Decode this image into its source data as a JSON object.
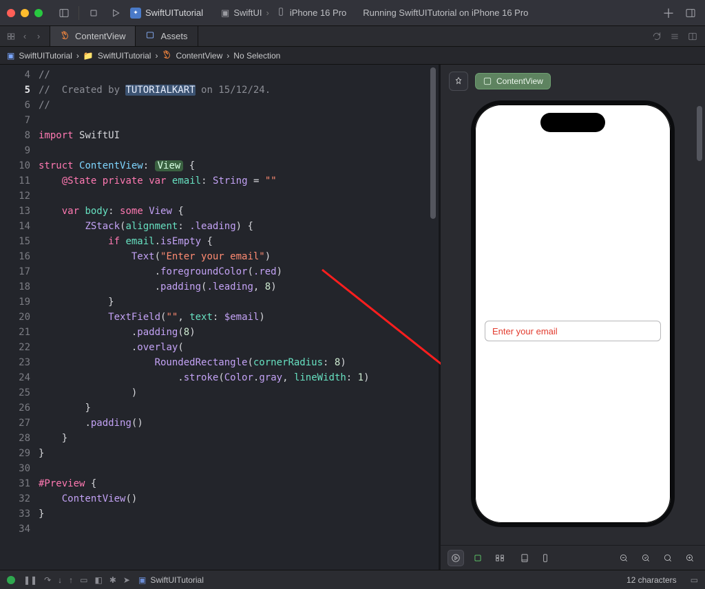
{
  "titlebar": {
    "scheme_name": "SwiftUITutorial",
    "device_name": "iPhone 16 Pro",
    "run_status": "Running SwiftUITutorial on iPhone 16 Pro",
    "alt_scheme": "SwiftUI"
  },
  "tabs": {
    "items": [
      {
        "label": "ContentView",
        "active": true
      },
      {
        "label": "Assets",
        "active": false
      }
    ]
  },
  "breadcrumb": {
    "project": "SwiftUITutorial",
    "folder": "SwiftUITutorial",
    "file": "ContentView",
    "selection": "No Selection"
  },
  "editor": {
    "first_line": 4,
    "current_line": 5,
    "lines": {
      "4": "//",
      "5": "//  Created by TUTORIALKART on 15/12/24.",
      "6": "//",
      "7": "",
      "8": "import SwiftUI",
      "9": "",
      "10": "struct ContentView: View {",
      "11": "    @State private var email: String = \"\"",
      "12": "",
      "13": "    var body: some View {",
      "14": "        ZStack(alignment: .leading) {",
      "15": "            if email.isEmpty {",
      "16": "                Text(\"Enter your email\")",
      "17": "                    .foregroundColor(.red)",
      "18": "                    .padding(.leading, 8)",
      "19": "            }",
      "20": "            TextField(\"\", text: $email)",
      "21": "                .padding(8)",
      "22": "                .overlay(",
      "23": "                    RoundedRectangle(cornerRadius: 8)",
      "24": "                        .stroke(Color.gray, lineWidth: 1)",
      "25": "                )",
      "26": "        }",
      "27": "        .padding()",
      "28": "    }",
      "29": "}",
      "30": "",
      "31": "#Preview {",
      "32": "    ContentView()",
      "33": "}",
      "34": ""
    },
    "highlighted_word_line5": "TUTORIALKART"
  },
  "preview": {
    "chip_label": "ContentView",
    "placeholder_text": "Enter your email"
  },
  "status": {
    "project": "SwiftUITutorial",
    "characters": "12 characters"
  }
}
